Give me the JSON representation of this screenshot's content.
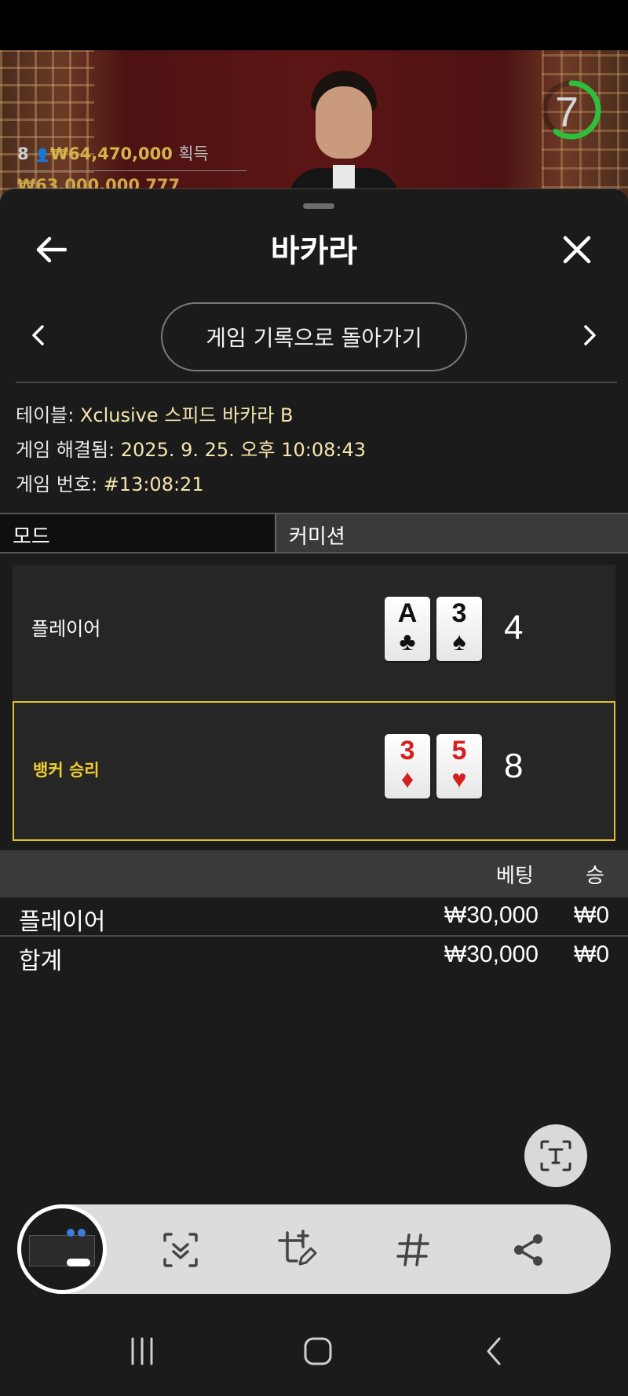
{
  "stream": {
    "players_count": "8",
    "win_amount": "₩64,470,000",
    "win_label": "획득",
    "second_line": "₩63,000,000  777",
    "timer": "7",
    "timer_fraction": 0.6,
    "timer_color": "#2fbf3a"
  },
  "header": {
    "title": "바카라",
    "back_icon": "arrow-left-icon",
    "close_icon": "close-icon"
  },
  "nav": {
    "back_to_history": "게임 기록으로 돌아가기",
    "prev_icon": "chevron-left-icon",
    "next_icon": "chevron-right-icon"
  },
  "info": {
    "table_label": "테이블:",
    "table_value": "Xclusive 스피드 바카라 B",
    "resolved_label": "게임 해결됨:",
    "resolved_value": "2025. 9. 25. 오후 10:08:43",
    "number_label": "게임 번호:",
    "number_value": "#13:08:21"
  },
  "tabs": {
    "mode": "모드",
    "commission": "커미션"
  },
  "hands": {
    "player": {
      "label": "플레이어",
      "cards": [
        {
          "rank": "A",
          "suit": "♣",
          "color": "black"
        },
        {
          "rank": "3",
          "suit": "♠",
          "color": "black"
        }
      ],
      "score": "4"
    },
    "banker": {
      "label": "뱅커 승리",
      "cards": [
        {
          "rank": "3",
          "suit": "♦",
          "color": "red"
        },
        {
          "rank": "5",
          "suit": "♥",
          "color": "red"
        }
      ],
      "score": "8",
      "highlight_color": "#e2c22a"
    }
  },
  "bets": {
    "col_bet": "베팅",
    "col_win": "승",
    "rows": [
      {
        "name": "플레이어",
        "bet": "₩30,000",
        "win": "₩0"
      }
    ],
    "total": {
      "name": "합계",
      "bet": "₩30,000",
      "win": "₩0"
    }
  },
  "toolbar": {
    "text_extract_icon": "text-extract-icon",
    "items": [
      "scroll-capture-icon",
      "crop-edit-icon",
      "hashtag-icon",
      "share-icon"
    ]
  },
  "navbar": {
    "items": [
      "recents-icon",
      "home-icon",
      "back-icon"
    ]
  }
}
